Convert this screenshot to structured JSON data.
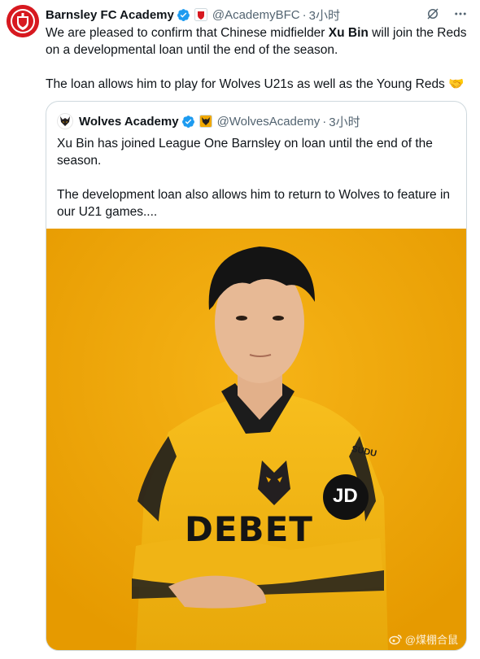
{
  "tweet": {
    "author_name": "Barnsley FC Academy",
    "author_handle": "@AcademyBFC",
    "dot": "·",
    "time": "3小时",
    "text_line1_pre": "We are pleased to confirm that Chinese midfielder ",
    "text_line1_bold": "Xu Bin",
    "text_line1_post": " will join the Reds",
    "text_line2": "on a developmental loan until the end of the season.",
    "text_line3": "The loan allows him to play for Wolves U21s as well as the Young Reds 🤝"
  },
  "quote": {
    "author_name": "Wolves Academy",
    "author_handle": "@WolvesAcademy",
    "dot": "·",
    "time": "3小时",
    "text_line1": "Xu Bin has joined League One Barnsley on loan until the end of the",
    "text_line2": "season.",
    "text_line3": "The development loan also allows him to return to Wolves to feature in",
    "text_line4": "our U21 games....",
    "photo": {
      "sponsor_text": "DEBET",
      "kit_brand": "SUDU",
      "sleeve_text": "JD"
    }
  },
  "watermark": {
    "text": "@煤棚合鼠"
  },
  "colors": {
    "brand_red": "#d71920",
    "verified_blue": "#1d9bf0",
    "wolves_gold": "#f1a800",
    "text_secondary": "#536471",
    "border": "#cfd9de"
  },
  "icons": {
    "verified": "verified-badge-icon",
    "grok": "grok-icon",
    "more": "more-dots-icon"
  }
}
